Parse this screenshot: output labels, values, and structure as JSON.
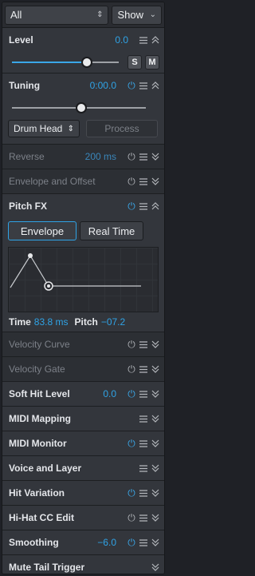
{
  "topbar": {
    "filter_value": "All",
    "filter_glyph": "⇕",
    "show_label": "Show",
    "show_glyph": "⌄"
  },
  "level": {
    "title": "Level",
    "value": "0.0",
    "slider_fraction": 0.7,
    "solo_label": "S",
    "mute_label": "M"
  },
  "tuning": {
    "title": "Tuning",
    "value": "0:00.0",
    "slider_fraction": 0.52,
    "mode_value": "Drum Head",
    "mode_glyph": "⇕",
    "process_label": "Process"
  },
  "reverse": {
    "title": "Reverse",
    "value": "200 ms"
  },
  "envelope_offset": {
    "title": "Envelope and Offset"
  },
  "pitch_fx": {
    "title": "Pitch FX",
    "tab_envelope": "Envelope",
    "tab_realtime": "Real Time",
    "time_label": "Time",
    "time_value": "83.8 ms",
    "pitch_label": "Pitch",
    "pitch_value": "−07.2"
  },
  "velocity_curve": {
    "title": "Velocity Curve"
  },
  "velocity_gate": {
    "title": "Velocity Gate"
  },
  "soft_hit_level": {
    "title": "Soft Hit Level",
    "value": "0.0"
  },
  "midi_mapping": {
    "title": "MIDI Mapping"
  },
  "midi_monitor": {
    "title": "MIDI Monitor"
  },
  "voice_layer": {
    "title": "Voice and Layer"
  },
  "hit_variation": {
    "title": "Hit Variation"
  },
  "hihat_cc": {
    "title": "Hi-Hat CC Edit"
  },
  "smoothing": {
    "title": "Smoothing",
    "value": "−6.0"
  },
  "mute_tail": {
    "title": "Mute Tail Trigger"
  },
  "icons": {
    "power": "⏻",
    "accent": "#2fa3e6"
  }
}
